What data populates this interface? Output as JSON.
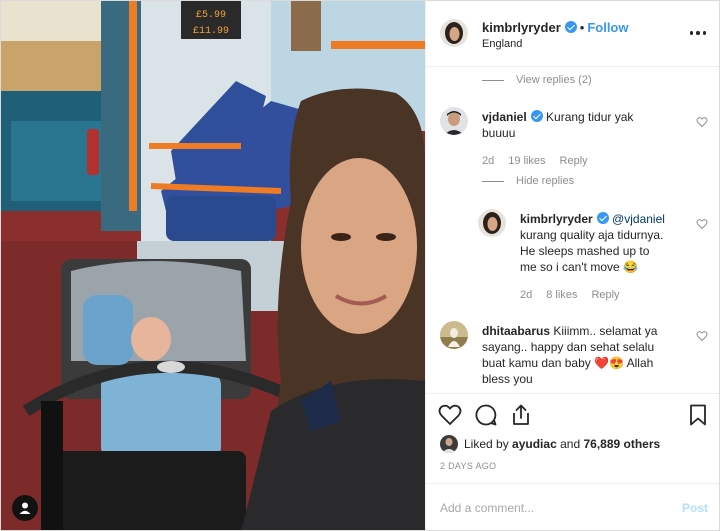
{
  "post": {
    "username": "kimbrlyryder",
    "follow_label": "Follow",
    "separator": "•",
    "location": "England"
  },
  "bus_sign": [
    "£5.99",
    "£11.99"
  ],
  "comments": {
    "view_replies_label": "View replies (2)",
    "hide_replies_label": "Hide replies",
    "items": [
      {
        "username": "vjdaniel",
        "text_lines": [
          "Kurang tidur yak",
          "buuuu"
        ],
        "age": "2d",
        "likes": "19 likes",
        "reply_label": "Reply"
      },
      {
        "username": "kimbrlyryder",
        "mention": "@vjdaniel",
        "text_lines": [
          "kurang quality aja tidurnya.",
          "He sleeps mashed up to",
          "me so i can't move 😂"
        ],
        "age": "2d",
        "likes": "8 likes",
        "reply_label": "Reply"
      },
      {
        "username": "dhitaabarus",
        "text_first": "Kiiimm.. selamat ya",
        "text_lines": [
          "sayang.. happy dan sehat selalu",
          "buat kamu dan baby ❤️😍 Allah",
          "bless you"
        ]
      }
    ]
  },
  "likes": {
    "prefix": "Liked by",
    "user": "ayudiac",
    "and_label": "and",
    "others": "76,889 others"
  },
  "date": "2 DAYS AGO",
  "add_comment": {
    "placeholder": "Add a comment...",
    "post_label": "Post"
  },
  "icons": {
    "more": "more-horizontal-icon",
    "like": "heart-icon",
    "comment": "comment-icon",
    "share": "share-icon",
    "save": "bookmark-icon",
    "tag": "user-tag-icon"
  },
  "colors": {
    "link_blue": "#3897f0",
    "post_disabled": "#b2dffc",
    "muted": "#8e8e8e"
  }
}
